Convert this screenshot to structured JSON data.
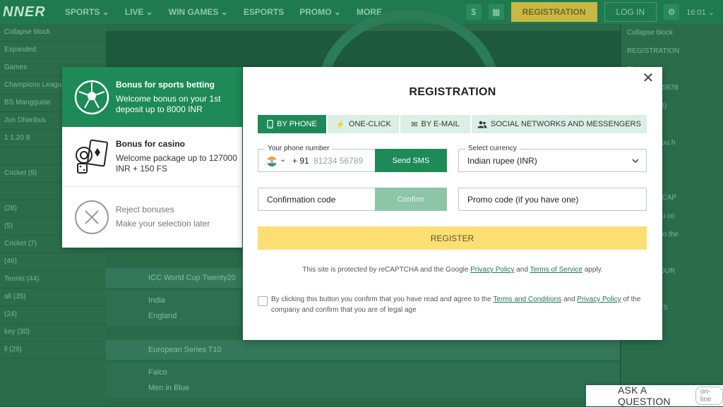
{
  "site": {
    "logo": "NNER",
    "nav": [
      "SPORTS ⌄",
      "LIVE ⌄",
      "WIN GAMES ⌄",
      "ESPORTS",
      "PROMO ⌄",
      "MORE ⌄"
    ],
    "registration_label": "REGISTRATION",
    "login_label": "LOG IN",
    "time": "16:01 ⌄",
    "left_rows": [
      "Collapse block",
      "Expanded",
      "Games",
      "Champions League",
      "BS Mangguide",
      "Jun Dhanbus",
      "1  1.20  8",
      "",
      "Cricket (9)",
      "",
      "(28)",
      "(5)",
      "Cricket (7)",
      "(46)",
      "Tennis (44)",
      "all (35)",
      "(24)",
      "key (30)",
      "ll (29)"
    ],
    "matches": [
      "ICC World Cup Twenty20",
      "India",
      "England",
      "European Series T10",
      "Falco",
      "Men in Blue"
    ],
    "right_rows": [
      "Collapse block",
      "REGISTRATION",
      "Phone",
      "+91  81234 5678",
      "Rupee (INR)",
      "ation code",
      "e code (if you h",
      "REGISTER",
      "",
      "ected by reCAP",
      "s button you co",
      "and agree to the",
      "",
      "ALS ON YOUR",
      "UP IN",
      "YOUR BETS"
    ]
  },
  "bonus": {
    "items": [
      {
        "title": "Bonus for sports betting",
        "desc": "Welcome bonus on your 1st deposit up to 8000 INR"
      },
      {
        "title": "Bonus for casino",
        "desc": "Welcome package up to 127000 INR + 150 FS"
      },
      {
        "title": "Reject bonuses",
        "desc": "Make your selection later"
      }
    ]
  },
  "modal": {
    "title": "REGISTRATION",
    "close": "✕",
    "tabs": [
      {
        "label": "BY PHONE",
        "icon": "phone-icon"
      },
      {
        "label": "ONE-CLICK",
        "icon": "lightning-icon"
      },
      {
        "label": "BY E-MAIL",
        "icon": "envelope-icon"
      },
      {
        "label": "SOCIAL NETWORKS AND MESSENGERS",
        "icon": "users-icon"
      }
    ],
    "phone": {
      "label": "Your phone number",
      "country_code": "+ 91",
      "placeholder": "81234 56789",
      "send_sms": "Send SMS"
    },
    "currency": {
      "label": "Select currency",
      "value": "Indian rupee (INR)"
    },
    "confirmation": {
      "placeholder": "Confirmation code",
      "confirm": "Confirm"
    },
    "promo": {
      "placeholder": "Promo code (if you have one)"
    },
    "register": "REGISTER",
    "recaptcha": {
      "prefix": "This site is protected by reCAPTCHA and the Google ",
      "privacy": "Privacy Policy",
      "and": " and ",
      "terms": "Terms of Service",
      "suffix": " apply."
    },
    "agree": {
      "prefix": "By clicking this button you confirm that you have read and agree to the ",
      "terms": "Terms and Conditions",
      "and": " and ",
      "privacy": "Privacy Policy",
      "suffix": " of the company and confirm that you are of legal age"
    }
  },
  "ask": {
    "label": "ASK A QUESTION",
    "status": "on-line"
  },
  "colors": {
    "brand_green": "#1d8a58",
    "register_yellow": "#fbdf74",
    "tab_inactive": "#dcefe4"
  }
}
